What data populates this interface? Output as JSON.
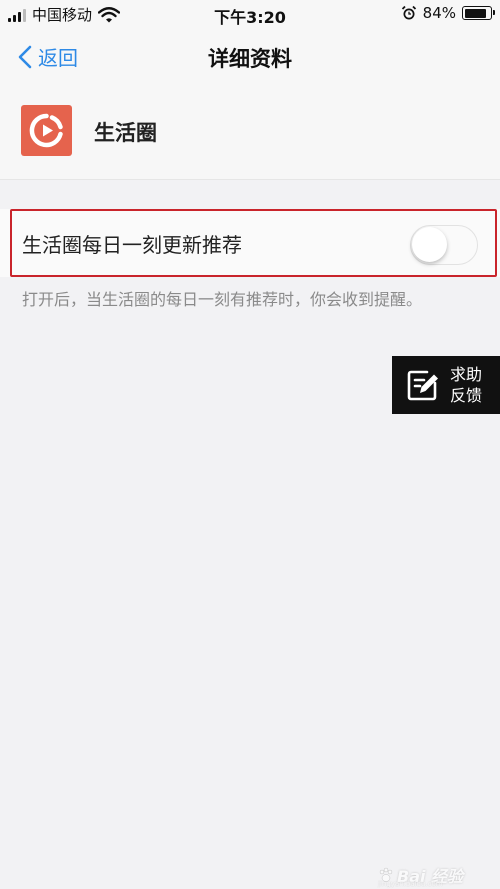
{
  "status_bar": {
    "carrier": "中国移动",
    "time": "下午3:20",
    "battery_text": "84%",
    "battery_level": 0.84
  },
  "nav": {
    "back_label": "返回",
    "title": "详细资料"
  },
  "app": {
    "name": "生活圈",
    "logo_icon": "play-circle-icon",
    "logo_color": "#e5634d"
  },
  "setting": {
    "label": "生活圈每日一刻更新推荐",
    "enabled": false,
    "description": "打开后，当生活圈的每日一刻有推荐时，你会收到提醒。"
  },
  "help": {
    "icon": "edit-note-icon",
    "line1": "求助",
    "line2": "反馈"
  },
  "watermark": {
    "logo": "Bai 经验",
    "sub": "jingyan.baidu.com"
  },
  "colors": {
    "accent": "#2e8ae6",
    "highlight": "#c9242b",
    "background": "#f2f2f4"
  }
}
